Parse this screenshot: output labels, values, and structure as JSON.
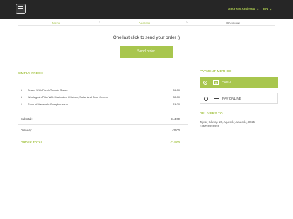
{
  "header": {
    "user_name": "Andreas Andreou",
    "language": "EN"
  },
  "steps": [
    {
      "label": "Menu"
    },
    {
      "label": "Address"
    },
    {
      "label": "Checkout"
    }
  ],
  "headline": "One last click to send your order :)",
  "send_button": "Send order",
  "restaurant": "SIMPLY FRESH",
  "order": {
    "items": [
      {
        "qty": "1",
        "name": "Beans With Fresh Tomato Sauce",
        "price": "€4.00"
      },
      {
        "qty": "1",
        "name": "Wholegrain Pitta With Marinated Chicken, Salad And Sour Cream",
        "price": "€6.00"
      },
      {
        "qty": "1",
        "name": "Soup of the week: Pumpkin soup",
        "price": "€4.00"
      }
    ],
    "subtotal_label": "Subtotal:",
    "subtotal_value": "€14.00",
    "delivery_label": "Delivery:",
    "delivery_value": "€0.00",
    "total_label": "ORDER TOTAL",
    "total_value": "€14.00"
  },
  "payment": {
    "title": "PAYMENT METHOD",
    "options": [
      {
        "label": "CASH",
        "icon": "euro-icon",
        "selected": true
      },
      {
        "label": "PAY ONLINE",
        "icon": "credit-card-icon",
        "selected": false
      }
    ]
  },
  "delivery": {
    "title": "DELIVERS TO",
    "address_line1": "Ζήνας Κάντερ 10, Λεμεσός Λεμεσός, 3025",
    "phone": "+35799999999"
  },
  "colors": {
    "accent": "#a8c64e",
    "topbar": "#262626"
  }
}
